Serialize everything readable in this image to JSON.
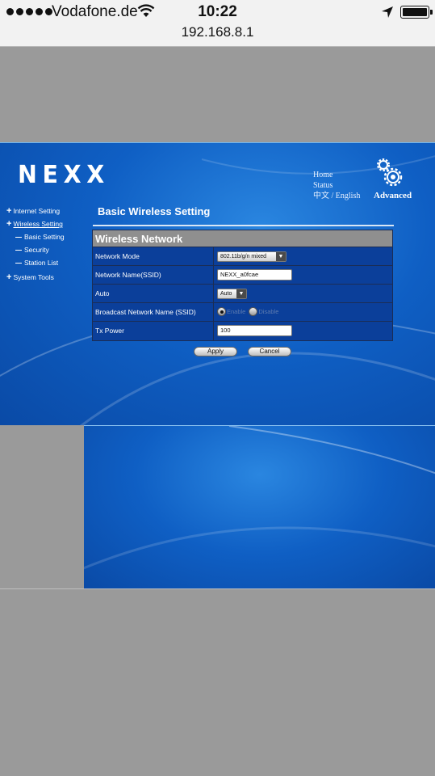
{
  "status_bar": {
    "carrier": "Vodafone.de",
    "time": "10:22",
    "icons": [
      "signal-dots",
      "wifi-icon",
      "location-icon",
      "battery-icon"
    ]
  },
  "browser": {
    "url": "192.168.8.1"
  },
  "router": {
    "logo": "NEXX",
    "top_links": [
      "Home",
      "Status",
      "中文 / English"
    ],
    "advanced_label": "Advanced",
    "menu": {
      "internet_setting": "Internet Setting",
      "wireless_setting": "Wireless Setting",
      "basic_setting": "Basic Setting",
      "security": "Security",
      "station_list": "Station List",
      "system_tools": "System Tools"
    },
    "page_title": "Basic Wireless Setting",
    "section_title": "Wireless Network",
    "fields": {
      "network_mode": {
        "label": "Network Mode",
        "value": "802.11b/g/n mixed"
      },
      "ssid": {
        "label": "Network Name(SSID)",
        "value": "NEXX_a0fcae"
      },
      "auto": {
        "label": "Auto",
        "value": "Auto"
      },
      "broadcast": {
        "label": "Broadcast Network Name (SSID)",
        "enable": "Enable",
        "disable": "Disable",
        "selected": "Enable"
      },
      "tx_power": {
        "label": "Tx Power",
        "value": "100"
      }
    },
    "apply_label": "Apply",
    "cancel_label": "Cancel"
  },
  "colors": {
    "page_bg": "#9a9a9a",
    "router_blue": "#0f5fc4",
    "header_gray": "#8f8f8f"
  }
}
